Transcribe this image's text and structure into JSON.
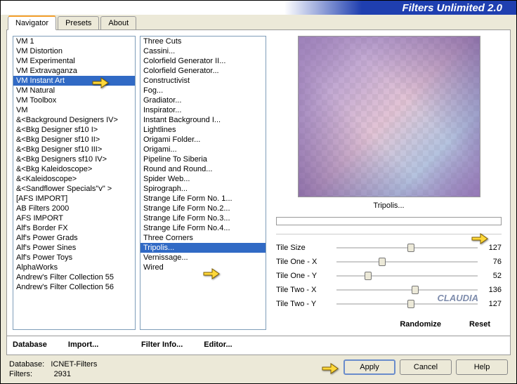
{
  "header": {
    "title": "Filters Unlimited 2.0"
  },
  "tabs": [
    "Navigator",
    "Presets",
    "About"
  ],
  "activeTab": 0,
  "categories": [
    "VM 1",
    "VM Distortion",
    "VM Experimental",
    "VM Extravaganza",
    "VM Instant Art",
    "VM Natural",
    "VM Toolbox",
    "VM",
    "&<Background Designers IV>",
    "&<Bkg Designer sf10 I>",
    "&<Bkg Designer sf10 II>",
    "&<Bkg Designer sf10 III>",
    "&<Bkg Designers sf10 IV>",
    "&<Bkg Kaleidoscope>",
    "&<Kaleidoscope>",
    "&<Sandflower Specials\"v\" >",
    "[AFS IMPORT]",
    "AB Filters 2000",
    "AFS IMPORT",
    "Alf's Border FX",
    "Alf's Power Grads",
    "Alf's Power Sines",
    "Alf's Power Toys",
    "AlphaWorks",
    "Andrew's Filter Collection 55",
    "Andrew's Filter Collection 56"
  ],
  "selectedCategory": "VM Instant Art",
  "filters": [
    "Three Cuts",
    "Cassini...",
    "Colorfield Generator II...",
    "Colorfield Generator...",
    "Constructivist",
    "Fog...",
    "Gradiator...",
    "Inspirator...",
    "Instant Background I...",
    "Lightlines",
    "Origami Folder...",
    "Origami...",
    "Pipeline To Siberia",
    "Round and Round...",
    "Spider Web...",
    "Spirograph...",
    "Strange Life Form No. 1...",
    "Strange Life Form No.2...",
    "Strange Life Form No.3...",
    "Strange Life Form No.4...",
    "Three Corners",
    "Tripolis...",
    "Vernissage...",
    "Wired"
  ],
  "selectedFilter": "Tripolis...",
  "previewLabel": "Tripolis...",
  "sliders": [
    {
      "label": "Tile Size",
      "value": 127,
      "pct": 50
    },
    {
      "label": "Tile One - X",
      "value": 76,
      "pct": 30
    },
    {
      "label": "Tile One - Y",
      "value": 52,
      "pct": 20
    },
    {
      "label": "Tile Two - X",
      "value": 136,
      "pct": 53
    },
    {
      "label": "Tile Two - Y",
      "value": 127,
      "pct": 50
    }
  ],
  "bottomLinksLeft": [
    "Database",
    "Import...",
    "Filter Info...",
    "Editor..."
  ],
  "bottomLinksRight": [
    "Randomize",
    "Reset"
  ],
  "footer": {
    "databaseLabel": "Database:",
    "databaseValue": "ICNET-Filters",
    "filtersLabel": "Filters:",
    "filtersValue": "2931"
  },
  "buttons": {
    "apply": "Apply",
    "cancel": "Cancel",
    "help": "Help"
  },
  "watermark": "CLAUDIA"
}
